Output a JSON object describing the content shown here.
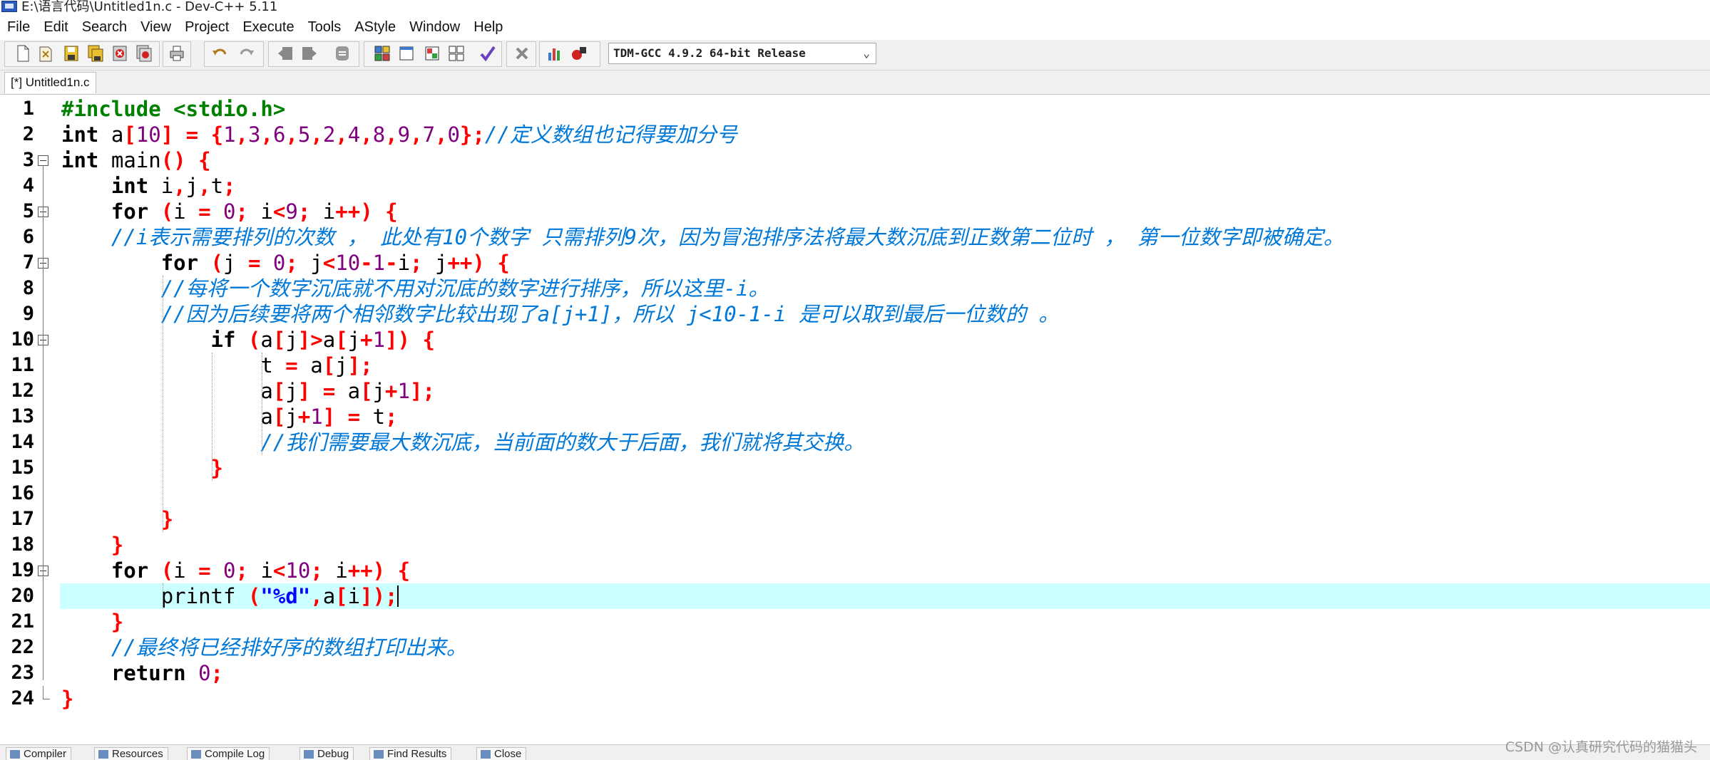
{
  "window": {
    "title": "E:\\语言代码\\Untitled1n.c - Dev-C++ 5.11"
  },
  "menu": [
    "File",
    "Edit",
    "Search",
    "View",
    "Project",
    "Execute",
    "Tools",
    "AStyle",
    "Window",
    "Help"
  ],
  "toolbar": {
    "compiler_selected": "TDM-GCC 4.9.2 64-bit Release",
    "icons": [
      "new-file-icon",
      "open-project-icon",
      "save-icon",
      "save-all-icon",
      "close-icon",
      "close-all-icon",
      "print-icon",
      "undo-icon",
      "redo-icon",
      "indent-icon",
      "unindent-icon",
      "toggle-comment-icon",
      "new-project-icon",
      "new-window-icon",
      "insert-icon",
      "toggle-bookmark-icon",
      "check-syntax-icon",
      "stop-icon",
      "chart-icon",
      "debug-icon"
    ]
  },
  "tab": {
    "label": "[*] Untitled1n.c"
  },
  "editor": {
    "current_line": 20,
    "lines": [
      {
        "n": "1",
        "text": "#include <stdio.h>"
      },
      {
        "n": "2",
        "text": "int a[10] = {1,3,6,5,2,4,8,9,7,0};//定义数组也记得要加分号"
      },
      {
        "n": "3",
        "text": "int main() {"
      },
      {
        "n": "4",
        "text": "    int i,j,t;"
      },
      {
        "n": "5",
        "text": "    for (i = 0; i<9; i++) {"
      },
      {
        "n": "6",
        "text": "    //i表示需要排列的次数 ， 此处有10个数字 只需排列9次，因为冒泡排序法将最大数沉底到正数第二位时 ， 第一位数字即被确定。"
      },
      {
        "n": "7",
        "text": "        for (j = 0; j<10-1-i; j++) {"
      },
      {
        "n": "8",
        "text": "        //每将一个数字沉底就不用对沉底的数字进行排序，所以这里-i。"
      },
      {
        "n": "9",
        "text": "        //因为后续要将两个相邻数字比较出现了a[j+1]，所以 j<10-1-i 是可以取到最后一位数的 。"
      },
      {
        "n": "10",
        "text": "            if (a[j]>a[j+1]) {"
      },
      {
        "n": "11",
        "text": "                t = a[j];"
      },
      {
        "n": "12",
        "text": "                a[j] = a[j+1];"
      },
      {
        "n": "13",
        "text": "                a[j+1] = t;"
      },
      {
        "n": "14",
        "text": "                //我们需要最大数沉底，当前面的数大于后面，我们就将其交换。"
      },
      {
        "n": "15",
        "text": "            }"
      },
      {
        "n": "16",
        "text": ""
      },
      {
        "n": "17",
        "text": "        }"
      },
      {
        "n": "18",
        "text": "    }"
      },
      {
        "n": "19",
        "text": "    for (i = 0; i<10; i++) {"
      },
      {
        "n": "20",
        "text": "        printf (\"%d\",a[i]);"
      },
      {
        "n": "21",
        "text": "    }"
      },
      {
        "n": "22",
        "text": "    //最终将已经排好序的数组打印出来。"
      },
      {
        "n": "23",
        "text": "    return 0;"
      },
      {
        "n": "24",
        "text": "}"
      }
    ]
  },
  "colors": {
    "keyword": "#000000",
    "number": "#800080",
    "operator": "#ff0000",
    "comment": "#0078d7",
    "preprocessor": "#008000",
    "string": "#0000ff",
    "current_line_bg": "#ccffff"
  },
  "bottom_tabs": [
    "Compiler",
    "Resources",
    "Compile Log",
    "Debug",
    "Find Results",
    "Close"
  ],
  "watermark": "CSDN @认真研究代码的猫猫头"
}
